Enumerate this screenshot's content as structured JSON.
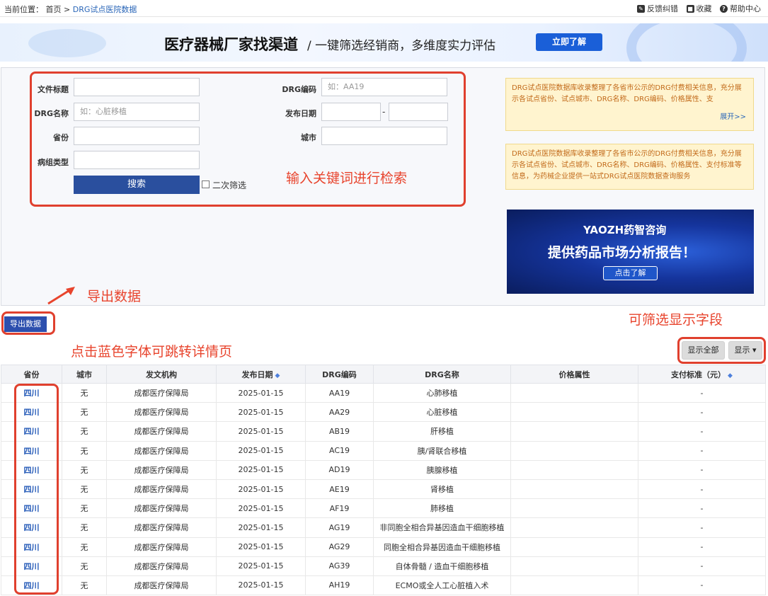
{
  "breadcrumb": {
    "prefix": "当前位置：",
    "home": "首页",
    "sep": ">",
    "current": "DRG试点医院数据"
  },
  "toplinks": {
    "feedback": "反馈纠错",
    "favorite": "收藏",
    "help": "帮助中心"
  },
  "banner": {
    "title": "医疗器械厂家找渠道",
    "subtitle": "/ 一键筛选经销商，多维度实力评估",
    "button": "立即了解"
  },
  "form": {
    "title_label": "文件标题",
    "title_value": "",
    "code_label": "DRG编码",
    "code_placeholder": "如：AA19",
    "name_label": "DRG名称",
    "name_placeholder": "如：心脏移植",
    "date_label": "发布日期",
    "date_sep": "-",
    "province_label": "省份",
    "city_label": "城市",
    "group_label": "病组类型",
    "search_button": "搜索",
    "secondary_filter": "二次筛选"
  },
  "annotations": {
    "keyword": "输入关键词进行检索",
    "export": "导出数据",
    "fields": "可筛选显示字段",
    "blue": "点击蓝色字体可跳转详情页"
  },
  "notices": [
    {
      "text": "DRG试点医院数据库收录整理了各省市公示的DRG付费相关信息，充分展示各试点省份、试点城市、DRG名称、DRG编码、价格属性、支",
      "expand": "展开>>"
    },
    {
      "text": "DRG试点医院数据库收录整理了各省市公示的DRG付费相关信息，充分展示各试点省份、试点城市、DRG名称、DRG编码、价格属性、支付标准等信息，为药械企业提供一站式DRG试点医院数据查询服务"
    }
  ],
  "ad": {
    "logo": "YAOZH药智咨询",
    "headline": "提供药品市场分析报告！",
    "button": "点击了解"
  },
  "toolbar": {
    "export": "导出数据",
    "show_all": "显示全部",
    "show": "显示"
  },
  "table": {
    "columns": [
      "省份",
      "城市",
      "发文机构",
      "发布日期",
      "DRG编码",
      "DRG名称",
      "价格属性",
      "支付标准（元）"
    ],
    "rows": [
      [
        "四川",
        "无",
        "成都医疗保障局",
        "2025-01-15",
        "AA19",
        "心肺移植",
        "",
        "-"
      ],
      [
        "四川",
        "无",
        "成都医疗保障局",
        "2025-01-15",
        "AA29",
        "心脏移植",
        "",
        "-"
      ],
      [
        "四川",
        "无",
        "成都医疗保障局",
        "2025-01-15",
        "AB19",
        "肝移植",
        "",
        "-"
      ],
      [
        "四川",
        "无",
        "成都医疗保障局",
        "2025-01-15",
        "AC19",
        "胰/肾联合移植",
        "",
        "-"
      ],
      [
        "四川",
        "无",
        "成都医疗保障局",
        "2025-01-15",
        "AD19",
        "胰腺移植",
        "",
        "-"
      ],
      [
        "四川",
        "无",
        "成都医疗保障局",
        "2025-01-15",
        "AE19",
        "肾移植",
        "",
        "-"
      ],
      [
        "四川",
        "无",
        "成都医疗保障局",
        "2025-01-15",
        "AF19",
        "肺移植",
        "",
        "-"
      ],
      [
        "四川",
        "无",
        "成都医疗保障局",
        "2025-01-15",
        "AG19",
        "非同胞全相合异基因造血干细胞移植",
        "",
        "-"
      ],
      [
        "四川",
        "无",
        "成都医疗保障局",
        "2025-01-15",
        "AG29",
        "同胞全相合异基因造血干细胞移植",
        "",
        "-"
      ],
      [
        "四川",
        "无",
        "成都医疗保障局",
        "2025-01-15",
        "AG39",
        "自体骨髓 / 造血干细胞移植",
        "",
        "-"
      ],
      [
        "四川",
        "无",
        "成都医疗保障局",
        "2025-01-15",
        "AH19",
        "ECMO或全人工心脏植入术",
        "",
        "-"
      ]
    ]
  },
  "colors": {
    "accent": "#2a4f9e",
    "link": "#1f56b6",
    "annotation": "#e8442d"
  }
}
